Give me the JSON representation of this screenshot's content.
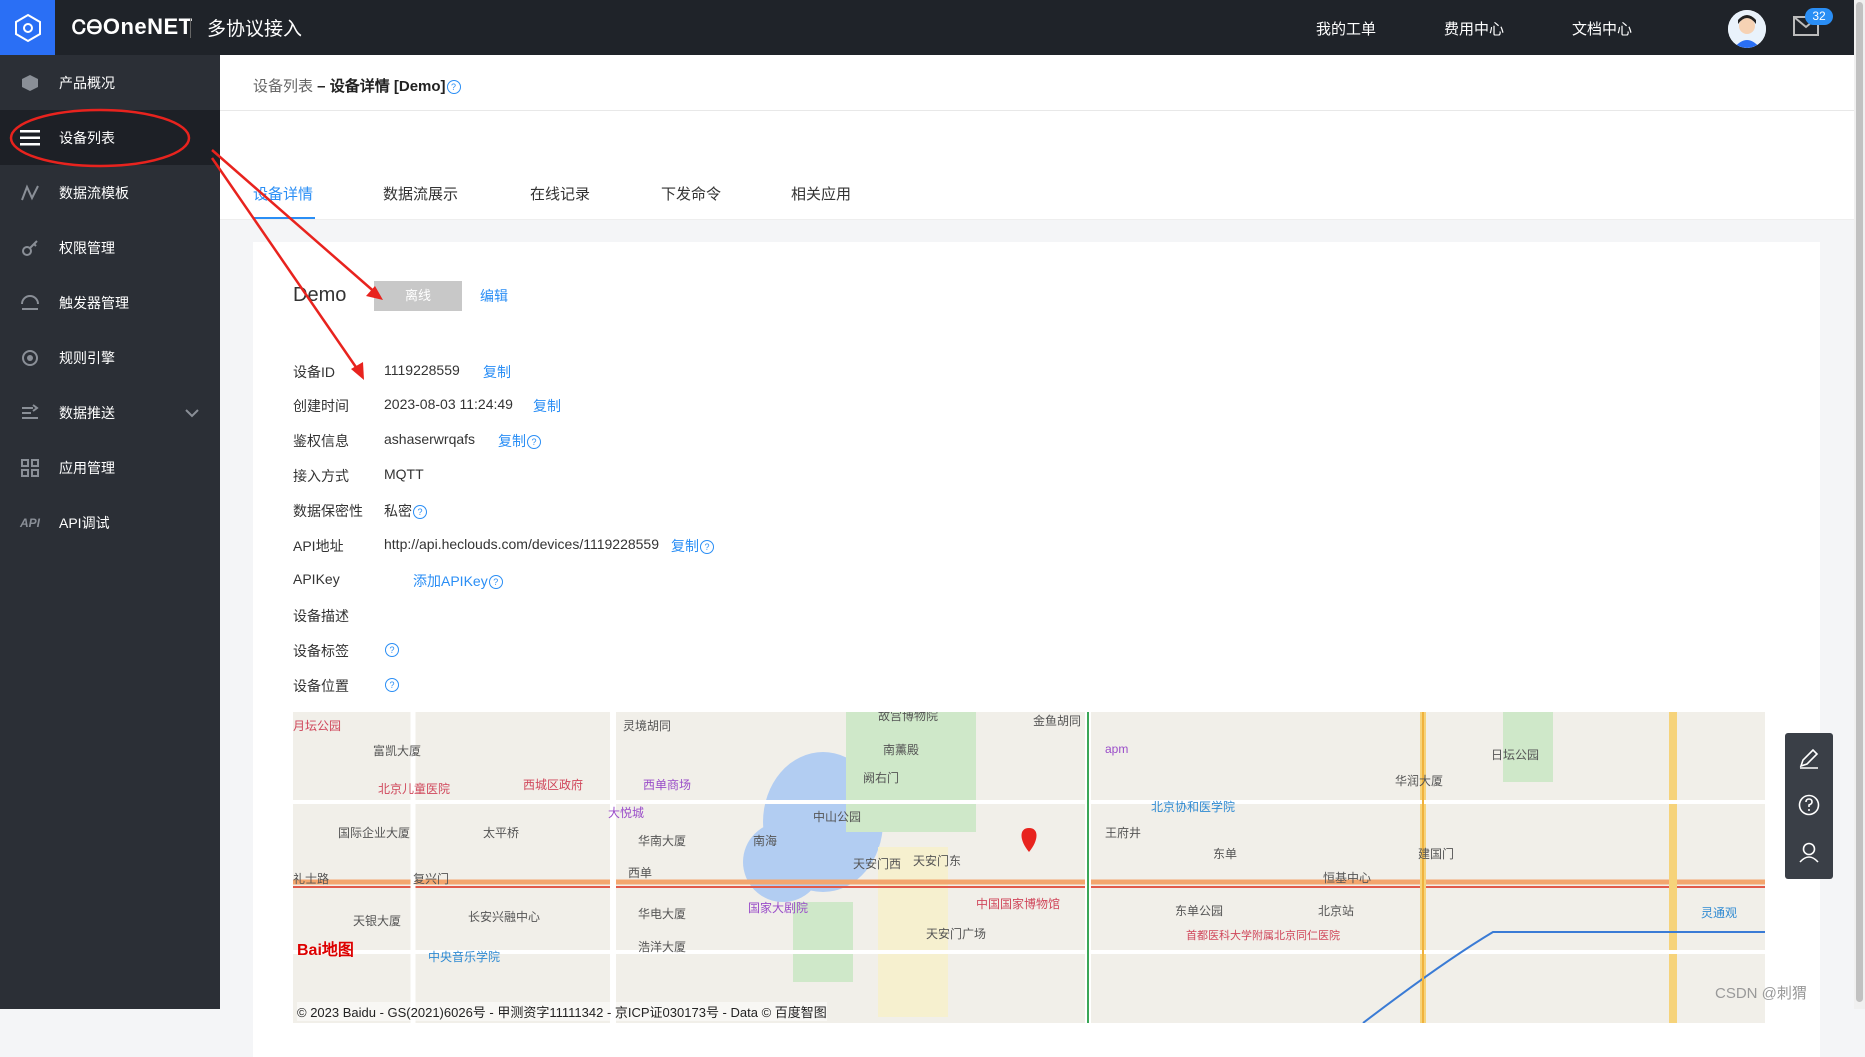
{
  "topbar": {
    "brand": "OneNET",
    "platform": "多协议接入",
    "links": [
      "我的工单",
      "费用中心",
      "文档中心"
    ],
    "mail_count": "32"
  },
  "sidebar": {
    "items": [
      {
        "label": "产品概况",
        "icon": "cube-icon"
      },
      {
        "label": "设备列表",
        "icon": "list-icon"
      },
      {
        "label": "数据流模板",
        "icon": "datastream-icon"
      },
      {
        "label": "权限管理",
        "icon": "key-icon"
      },
      {
        "label": "触发器管理",
        "icon": "trigger-icon"
      },
      {
        "label": "规则引擎",
        "icon": "rule-icon"
      },
      {
        "label": "数据推送",
        "icon": "push-icon"
      },
      {
        "label": "应用管理",
        "icon": "grid-icon"
      },
      {
        "label": "API调试",
        "icon": "api-icon"
      }
    ]
  },
  "breadcrumb": {
    "parent": "设备列表",
    "sep": " – ",
    "current": "设备详情 [Demo]"
  },
  "tabs": [
    "设备详情",
    "数据流展示",
    "在线记录",
    "下发命令",
    "相关应用"
  ],
  "device": {
    "name": "Demo",
    "status": "离线",
    "edit": "编辑",
    "rows": [
      {
        "label": "设备ID",
        "value": "1119228559",
        "action": "复制"
      },
      {
        "label": "创建时间",
        "value": "2023-08-03 11:24:49",
        "action": "复制"
      },
      {
        "label": "鉴权信息",
        "value": "ashaserwrqafs",
        "action": "复制"
      },
      {
        "label": "接入方式",
        "value": "MQTT"
      },
      {
        "label": "数据保密性",
        "value": "私密"
      },
      {
        "label": "API地址",
        "value": "http://api.heclouds.com/devices/1119228559",
        "action": "复制"
      },
      {
        "label": "APIKey",
        "action": "添加APIKey"
      },
      {
        "label": "设备描述"
      },
      {
        "label": "设备标签"
      },
      {
        "label": "设备位置"
      }
    ]
  },
  "map": {
    "copyright": "© 2023 Baidu - GS(2021)6026号 - 甲测资字11111342 - 京ICP证030173号 - Data © 百度智图",
    "logo": "Bai地图",
    "labels": [
      "灵境胡同",
      "富凯大厦",
      "北京儿童医院",
      "西城区政府",
      "西单商场",
      "大悦城",
      "国际企业大厦",
      "太平桥",
      "华南大厦",
      "中山公园",
      "南海",
      "复兴门",
      "西单",
      "天安门西",
      "天安门东",
      "王府井",
      "东单",
      "建国门",
      "北京协和医学院",
      "阙右门",
      "南薰殿",
      "金鱼胡同",
      "华润大厦",
      "日坛公园",
      "中国国家博物馆",
      "国家大剧院",
      "天安门广场",
      "东单公园",
      "北京站",
      "恒基中心",
      "华电大厦",
      "浩洋大厦",
      "长安兴融中心",
      "天银大厦",
      "礼士路",
      "首都医科大学附属北京同仁医院",
      "中央音乐学院",
      "灵通观",
      "故宫博物院",
      "apm",
      "月坛公园"
    ]
  },
  "watermark": "CSDN @刺猬",
  "colors": {
    "accent": "#2a8ef5",
    "sidebar": "#2b2f36",
    "topbar": "#1f2329",
    "annotation": "#e8231e"
  }
}
